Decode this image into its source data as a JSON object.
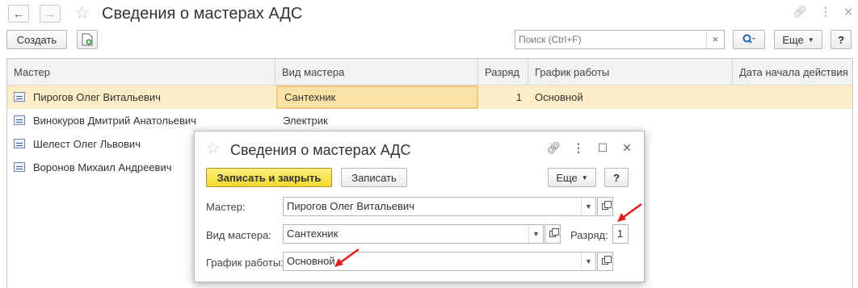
{
  "window": {
    "title": "Сведения о мастерах АДС",
    "back_label": "←",
    "forward_label": "→"
  },
  "toolbar": {
    "create_label": "Создать",
    "search_placeholder": "Поиск (Ctrl+F)",
    "search_clear": "×",
    "more_label": "Еще",
    "help_label": "?"
  },
  "table": {
    "columns": [
      "Мастер",
      "Вид мастера",
      "Разряд",
      "График работы",
      "Дата начала действия"
    ],
    "rows": [
      {
        "master": "Пирогов Олег Витальевич",
        "type": "Сантехник",
        "grade": "1",
        "schedule": "Основной",
        "start": ""
      },
      {
        "master": "Винокуров Дмитрий Анатольевич",
        "type": "Электрик",
        "grade": "",
        "schedule": "",
        "start": ""
      },
      {
        "master": "Шелест Олег Львович",
        "type": "",
        "grade": "",
        "schedule": "",
        "start": ""
      },
      {
        "master": "Воронов Михаил Андреевич",
        "type": "",
        "grade": "",
        "schedule": "",
        "start": ""
      }
    ]
  },
  "dialog": {
    "title": "Сведения о мастерах АДС",
    "save_close_label": "Записать и закрыть",
    "save_label": "Записать",
    "more_label": "Еще",
    "help_label": "?",
    "master_label": "Мастер:",
    "master_value": "Пирогов Олег Витальевич",
    "type_label": "Вид мастера:",
    "type_value": "Сантехник",
    "grade_label": "Разряд:",
    "grade_value": "1",
    "schedule_label": "График работы:",
    "schedule_value": "Основной"
  },
  "colors": {
    "accent_yellow": "#f9e24b",
    "selected_row": "#fbedc5",
    "arrow_red": "#e02020"
  }
}
